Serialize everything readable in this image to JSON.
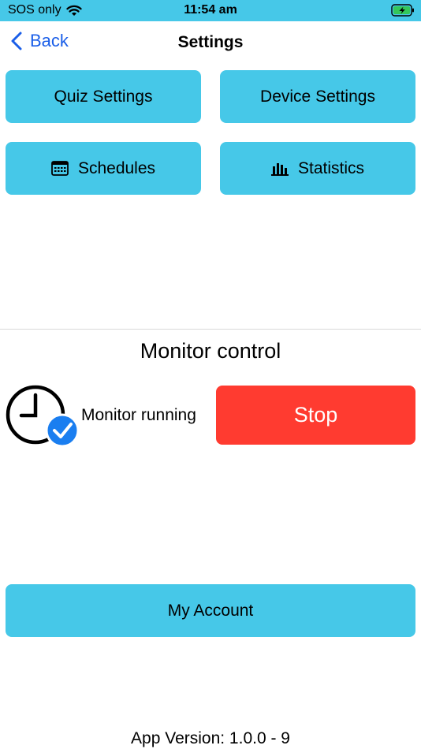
{
  "status_bar": {
    "carrier": "SOS only",
    "time": "11:54 am"
  },
  "nav": {
    "back_label": "Back",
    "title": "Settings"
  },
  "menu": {
    "quiz_settings": "Quiz Settings",
    "device_settings": "Device Settings",
    "schedules": "Schedules",
    "statistics": "Statistics"
  },
  "monitor": {
    "title": "Monitor control",
    "status_text": "Monitor running",
    "stop_label": "Stop"
  },
  "account": {
    "label": "My Account"
  },
  "footer": {
    "version": "App Version: 1.0.0 - 9"
  },
  "colors": {
    "accent": "#46c8e8",
    "stop": "#ff3b30",
    "link": "#1a5ee8",
    "check": "#1a7ef0"
  }
}
